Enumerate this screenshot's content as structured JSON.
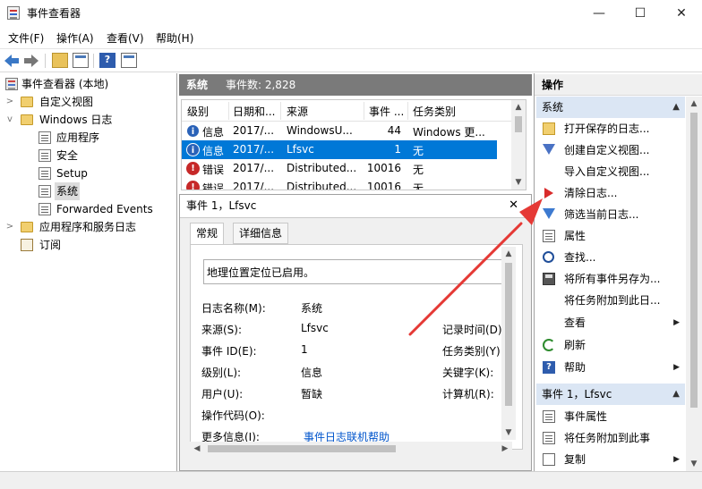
{
  "window": {
    "title": "事件查看器",
    "controls": {
      "minimize": "—",
      "maximize": "☐",
      "close": "✕"
    }
  },
  "menu": [
    "文件(F)",
    "操作(A)",
    "查看(V)",
    "帮助(H)"
  ],
  "toolbar": {
    "icons": [
      "back-icon",
      "forward-icon",
      "folder-up-icon",
      "show-hide-tree-icon",
      "help-icon",
      "show-hide-action-icon"
    ],
    "help_glyph": "?"
  },
  "tree": {
    "root": "事件查看器 (本地)",
    "custom_views": "自定义视图",
    "windows_logs": "Windows 日志",
    "logs": [
      "应用程序",
      "安全",
      "Setup",
      "系统",
      "Forwarded Events"
    ],
    "app_services": "应用程序和服务日志",
    "subscriptions": "订阅",
    "selected": "系统"
  },
  "log_header": {
    "name": "系统",
    "count_label": "事件数: 2,828"
  },
  "grid": {
    "columns": [
      "级别",
      "日期和...",
      "来源",
      "事件 ...",
      "任务类别"
    ],
    "rows": [
      {
        "level": "信息",
        "level_kind": "info",
        "date": "2017/...",
        "source": "WindowsU...",
        "event_id": "44",
        "category": "Windows 更..."
      },
      {
        "level": "信息",
        "level_kind": "info",
        "date": "2017/...",
        "source": "Lfsvc",
        "event_id": "1",
        "category": "无",
        "selected": true
      },
      {
        "level": "错误",
        "level_kind": "error",
        "date": "2017/...",
        "source": "Distributed...",
        "event_id": "10016",
        "category": "无"
      },
      {
        "level": "错误",
        "level_kind": "error",
        "date": "2017/...",
        "source": "Distributed...",
        "event_id": "10016",
        "category": "无"
      }
    ]
  },
  "detail": {
    "title": "事件 1，Lfsvc",
    "close": "✕",
    "tabs": [
      "常规",
      "详细信息"
    ],
    "message": "地理位置定位已启用。",
    "fields": {
      "log_name_label": "日志名称(M):",
      "log_name": "系统",
      "source_label": "来源(S):",
      "source": "Lfsvc",
      "event_id_label": "事件 ID(E):",
      "event_id": "1",
      "level_label": "级别(L):",
      "level": "信息",
      "user_label": "用户(U):",
      "user": "暂缺",
      "opcode_label": "操作代码(O):",
      "more_info_label": "更多信息(I):",
      "more_info_link": "事件日志联机帮助",
      "logged_label": "记录时间(D)",
      "task_category_label": "任务类别(Y):",
      "keywords_label": "关键字(K):",
      "computer_label": "计算机(R):"
    }
  },
  "actions": {
    "title": "操作",
    "group1": "系统",
    "items1": [
      {
        "label": "打开保存的日志...",
        "icon": "open-log-icon"
      },
      {
        "label": "创建自定义视图...",
        "icon": "create-view-icon"
      },
      {
        "label": "导入自定义视图...",
        "icon": ""
      },
      {
        "label": "清除日志...",
        "icon": "clear-log-icon"
      },
      {
        "label": "筛选当前日志...",
        "icon": "filter-icon"
      },
      {
        "label": "属性",
        "icon": "properties-icon"
      },
      {
        "label": "查找...",
        "icon": "find-icon"
      },
      {
        "label": "将所有事件另存为...",
        "icon": "save-icon"
      },
      {
        "label": "将任务附加到此日...",
        "icon": ""
      },
      {
        "label": "查看",
        "icon": "",
        "submenu": true
      },
      {
        "label": "刷新",
        "icon": "refresh-icon"
      },
      {
        "label": "帮助",
        "icon": "help-icon",
        "submenu": true
      }
    ],
    "group2": "事件 1，Lfsvc",
    "items2": [
      {
        "label": "事件属性",
        "icon": "event-properties-icon"
      },
      {
        "label": "将任务附加到此事",
        "icon": "attach-task-icon"
      },
      {
        "label": "复制",
        "icon": "copy-icon",
        "submenu": true
      }
    ]
  },
  "colors": {
    "selection": "#0078d7",
    "header_gray": "#7a7a7a",
    "annotation_arrow": "#e53935",
    "action_group_bg": "#dbe6f4"
  }
}
